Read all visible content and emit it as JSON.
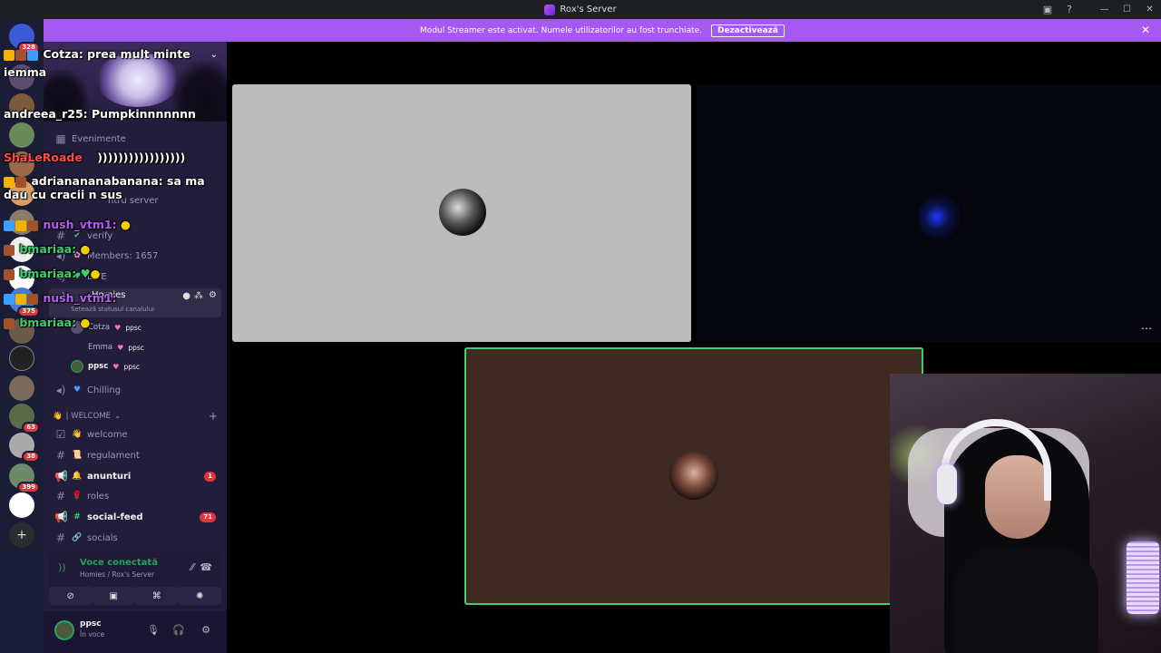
{
  "titlebar": {
    "title": "Rox's Server"
  },
  "banner": {
    "text": "Modul Streamer este activat. Numele utilizatorilor au fost trunchiate.",
    "button": "Dezactivează"
  },
  "servers": [
    {
      "badge": "328",
      "color": "#3b5bd9"
    },
    {
      "badge": "",
      "color": "#5a4e6e"
    },
    {
      "badge": "",
      "color": "#7a5a3a"
    },
    {
      "badge": "",
      "color": "#6a8a5a"
    },
    {
      "badge": "",
      "color": "#9a6a4a"
    },
    {
      "badge": "",
      "color": "#4a6a8a"
    },
    {
      "badge": "",
      "color": "#d9a066"
    },
    {
      "badge": "",
      "color": "#8a7a6a"
    },
    {
      "badge": "",
      "color": "#5a7a5a"
    },
    {
      "badge": "375",
      "color": "#4a7ad9"
    },
    {
      "badge": "",
      "color": "#6a5a4a"
    },
    {
      "badge": "",
      "color": "#222222"
    },
    {
      "badge": "",
      "color": "#7a6a5a"
    },
    {
      "badge": "63",
      "color": "#5a6a4a"
    },
    {
      "badge": "38",
      "color": "#aaaaaa"
    },
    {
      "badge": "399",
      "color": "#6a8a6a"
    },
    {
      "badge": "",
      "color": "#ffffff"
    }
  ],
  "server_name": "Cotza",
  "channels": {
    "events": "Evenimente",
    "server_label": "ntru server",
    "verify": "verify",
    "members": "Members: 1657",
    "live": "LIVE",
    "homies": "Homies",
    "status_hint": "Setează statusul canalului",
    "voice_users": [
      {
        "name": "Cotza",
        "tag": "ppsc"
      },
      {
        "name": "Emma",
        "tag": "ppsc"
      },
      {
        "name": "ppsc",
        "tag": "ppsc"
      }
    ],
    "chilling": "Chilling",
    "category": "| WELCOME",
    "welcome": "welcome",
    "regulament": "regulament",
    "anunturi": "anunturi",
    "anunturi_badge": "1",
    "roles": "roles",
    "social_feed": "social-feed",
    "social_feed_badge": "71",
    "socials": "socials"
  },
  "voice_panel": {
    "title": "Voce conectată",
    "sub": "Homies / Rox's Server"
  },
  "user": {
    "name": "ppsc",
    "status": "În voce"
  },
  "chat_overlay": [
    {
      "user": "Cotza",
      "text": "prea mult minte",
      "color": "white"
    },
    {
      "user": "",
      "text": "iemma",
      "color": "white"
    },
    {
      "user": "andreea_r25:",
      "text": "Pumpkinnnnnnn",
      "color": "white"
    },
    {
      "user": "ShaLeRoade",
      "text": ")))))))))))))))))",
      "color": "red"
    },
    {
      "user": "adrianananabanana:",
      "text": "sa ma dau cu cracii n sus",
      "color": "white"
    },
    {
      "user": "nush_vtm1:",
      "text": "",
      "color": "purple"
    },
    {
      "user": "bmariaa:",
      "text": "",
      "color": "green"
    },
    {
      "user": "bmariaa:",
      "text": "",
      "color": "green"
    },
    {
      "user": "nush_vtm1:",
      "text": "",
      "color": "purple"
    },
    {
      "user": "bmariaa:",
      "text": "",
      "color": "green"
    }
  ]
}
